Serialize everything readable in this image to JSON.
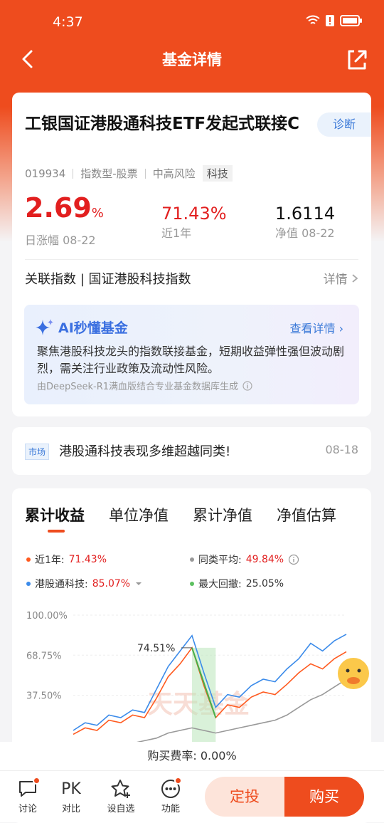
{
  "status": {
    "time": "4:37"
  },
  "nav": {
    "title": "基金详情"
  },
  "fund": {
    "name": "工银国证港股通科技ETF发起式联接C",
    "diagnose_label": "诊断",
    "code": "019934",
    "type": "指数型-股票",
    "risk": "中高风险",
    "theme_tag": "科技"
  },
  "stats": {
    "daily_change": "2.69",
    "daily_change_unit": "%",
    "daily_label": "日涨幅 08-22",
    "year_return": "71.43%",
    "year_label": "近1年",
    "nav_value": "1.6114",
    "nav_label": "净值 08-22"
  },
  "index": {
    "label": "关联指数 | 国证港股科技指数",
    "more": "详情"
  },
  "ai": {
    "title": "AI秒懂基金",
    "more": "查看详情",
    "text": "聚焦港股科技龙头的指数联接基金，短期收益弹性强但波动剧烈，需关注行业政策及流动性风险。",
    "note": "由DeepSeek-R1满血版结合专业基金数据库生成"
  },
  "news": {
    "tag": "市场",
    "title": "港股通科技表现多维超越同类!",
    "date": "08-18"
  },
  "tabs": [
    "累计收益",
    "单位净值",
    "累计净值",
    "净值估算"
  ],
  "legend": {
    "fund": {
      "label": "近1年: ",
      "value": "71.43%"
    },
    "peer": {
      "label": "同类平均: ",
      "value": "49.84%"
    },
    "index": {
      "label": "港股通科技: ",
      "value": "85.07%"
    },
    "drawdown": {
      "label": "最大回撤: ",
      "value": "25.05%"
    }
  },
  "chart_data": {
    "type": "line",
    "y_ticks": [
      "100.00%",
      "68.75%",
      "37.50%"
    ],
    "annotation": "74.51%",
    "watermark": "天天基金",
    "series": [
      {
        "name": "近1年",
        "color": "#ff5a1f",
        "values": [
          7,
          12,
          10,
          18,
          16,
          22,
          20,
          35,
          52,
          62,
          74.51,
          45,
          20,
          30,
          28,
          36,
          40,
          38,
          46,
          55,
          62,
          58,
          66,
          71.43
        ]
      },
      {
        "name": "港股通科技",
        "color": "#3b8bea",
        "values": [
          10,
          16,
          14,
          22,
          20,
          26,
          24,
          42,
          60,
          72,
          84,
          55,
          28,
          38,
          36,
          45,
          50,
          48,
          58,
          66,
          78,
          72,
          80,
          85.07
        ]
      },
      {
        "name": "同类平均",
        "color": "#999999",
        "values": [
          -10,
          -8,
          -6,
          -5,
          -3,
          0,
          2,
          4,
          8,
          10,
          12,
          10,
          8,
          10,
          12,
          14,
          16,
          18,
          22,
          28,
          34,
          38,
          44,
          49.84
        ]
      }
    ],
    "ylim": [
      20,
      100
    ]
  },
  "fee": {
    "label": "购买费率: 0.00%"
  },
  "bottom": {
    "discuss": "讨论",
    "compare": "对比",
    "compare_icon_text": "PK",
    "watch": "设自选",
    "more": "功能",
    "fixed_invest": "定投",
    "buy": "购买"
  }
}
